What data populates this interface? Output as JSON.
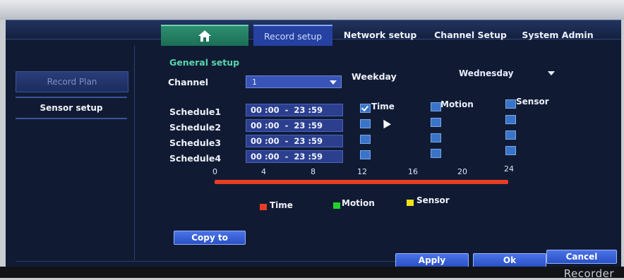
{
  "tabs": {
    "home_icon": "home-icon",
    "record_setup": "Record setup",
    "network_setup": "Network setup",
    "channel_setup": "Channel Setup",
    "system_admin": "System Admin"
  },
  "sidebar": {
    "items": [
      {
        "label": "Record Plan"
      },
      {
        "label": "Sensor setup"
      }
    ]
  },
  "general": {
    "title": "General setup",
    "channel_label": "Channel",
    "channel_value": "1",
    "weekday_label": "Weekday",
    "weekday_value": "Wednesday"
  },
  "schedules": [
    {
      "label": "Schedule1",
      "time": "00 :00  -  23 :59",
      "time_checked": true,
      "motion_checked": false,
      "sensor_checked": false
    },
    {
      "label": "Schedule2",
      "time": "00 :00  -  23 :59",
      "time_checked": false,
      "motion_checked": false,
      "sensor_checked": false
    },
    {
      "label": "Schedule3",
      "time": "00 :00  -  23 :59",
      "time_checked": false,
      "motion_checked": false,
      "sensor_checked": false
    },
    {
      "label": "Schedule4",
      "time": "00 :00  -  23 :59",
      "time_checked": false,
      "motion_checked": false,
      "sensor_checked": false
    }
  ],
  "check_columns": {
    "time": "Time",
    "motion": "Motion",
    "sensor": "Sensor"
  },
  "timeline": {
    "ticks": [
      "0",
      "4",
      "8",
      "12",
      "16",
      "20",
      "24"
    ],
    "bar_color": "#e83c25"
  },
  "legend": [
    {
      "label": "Time",
      "color": "#e83c25"
    },
    {
      "label": "Motion",
      "color": "#22d12a"
    },
    {
      "label": "Sensor",
      "color": "#f1e21a"
    }
  ],
  "buttons": {
    "copy_to": "Copy to",
    "apply": "Apply",
    "ok": "Ok",
    "cancel": "Cancel"
  },
  "branding": {
    "bottom_text": "Recorder"
  }
}
